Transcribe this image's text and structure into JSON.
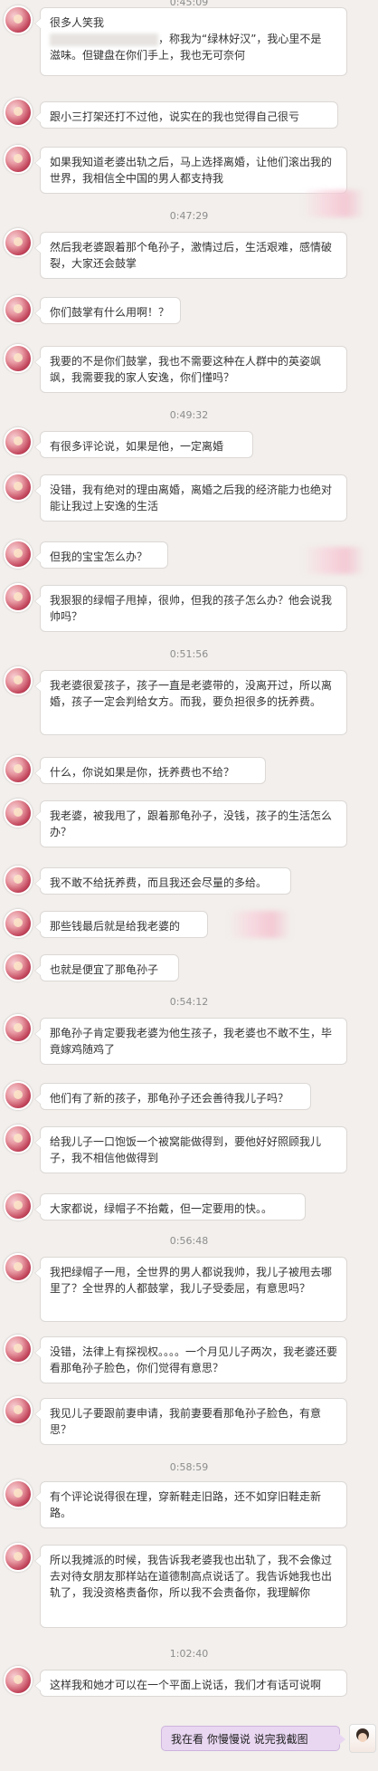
{
  "timestamps": [
    "0:45:09",
    "0:47:29",
    "0:49:32",
    "0:51:56",
    "0:54:12",
    "0:56:48",
    "0:58:59",
    "1:02:40"
  ],
  "messages": [
    {
      "line1": "很多人笑我",
      "line2": "，称我为“绿林好汉”，我心里不是",
      "line3": "滋味。但键盘在你们手上，我也无可奈何"
    },
    {
      "text": "跟小三打架还打不过他，说实在的我也觉得自己很亏"
    },
    {
      "text": "如果我知道老婆出轨之后，马上选择离婚，让他们滚出我的世界，我相信全中国的男人都支持我"
    },
    {
      "text": "然后我老婆跟着那个龟孙子，激情过后，生活艰难，感情破裂，大家还会鼓掌"
    },
    {
      "text": "你们鼓掌有什么用啊！？"
    },
    {
      "text": "我要的不是你们鼓掌，我也不需要这种在人群中的英姿飒飒，我需要我的家人安逸，你们懂吗？"
    },
    {
      "text": "有很多评论说，如果是他，一定离婚"
    },
    {
      "text": "没错，我有绝对的理由离婚，离婚之后我的经济能力也绝对能让我过上安逸的生活"
    },
    {
      "text": "但我的宝宝怎么办？"
    },
    {
      "text": "我狠狠的绿帽子甩掉，很帅，但我的孩子怎么办？他会说我帅吗？"
    },
    {
      "text": "我老婆很爱孩子，孩子一直是老婆带的，没离开过，所以离婚，孩子一定会判给女方。而我，要负担很多的抚养费。"
    },
    {
      "text": "什么，你说如果是你，抚养费也不给？"
    },
    {
      "text": "我老婆，被我甩了，跟着那龟孙子，没钱，孩子的生活怎么办？"
    },
    {
      "text": "我不敢不给抚养费，而且我还会尽量的多给。"
    },
    {
      "text": "那些钱最后就是给我老婆的"
    },
    {
      "text": "也就是便宜了那龟孙子"
    },
    {
      "text": "那龟孙子肯定要我老婆为他生孩子，我老婆也不敢不生，毕竟嫁鸡随鸡了"
    },
    {
      "text": "他们有了新的孩子，那龟孙子还会善待我儿子吗？"
    },
    {
      "text": "给我儿子一口饱饭一个被窝能做得到，要他好好照顾我儿子，我不相信他做得到"
    },
    {
      "text": "大家都说，绿帽子不抬戴，但一定要用的快。。"
    },
    {
      "text": "我把绿帽子一甩，全世界的男人都说我帅，我儿子被甩去哪里了？全世界的人都鼓掌，我儿子受委屈，有意思吗？"
    },
    {
      "text": "没错，法律上有探视权。。。。一个月见儿子两次，我老婆还要看那龟孙子脸色，你们觉得有意思？"
    },
    {
      "text": "我见儿子要跟前妻申请，我前妻要看那龟孙子脸色，有意思？"
    },
    {
      "text": "有个评论说得很在理，穿新鞋走旧路，还不如穿旧鞋走新路。"
    },
    {
      "text": "所以我摊派的时候，我告诉我老婆我也出轨了，我不会像过去对待女朋友那样站在道德制高点说话了。我告诉她我也出轨了，我没资格责备你，所以我不会责备你，我理解你"
    },
    {
      "text": "这样我和她才可以在一个平面上说话，我们才有话可说啊"
    }
  ],
  "reply": {
    "text": "我在看 你慢慢说 说完我截图"
  }
}
